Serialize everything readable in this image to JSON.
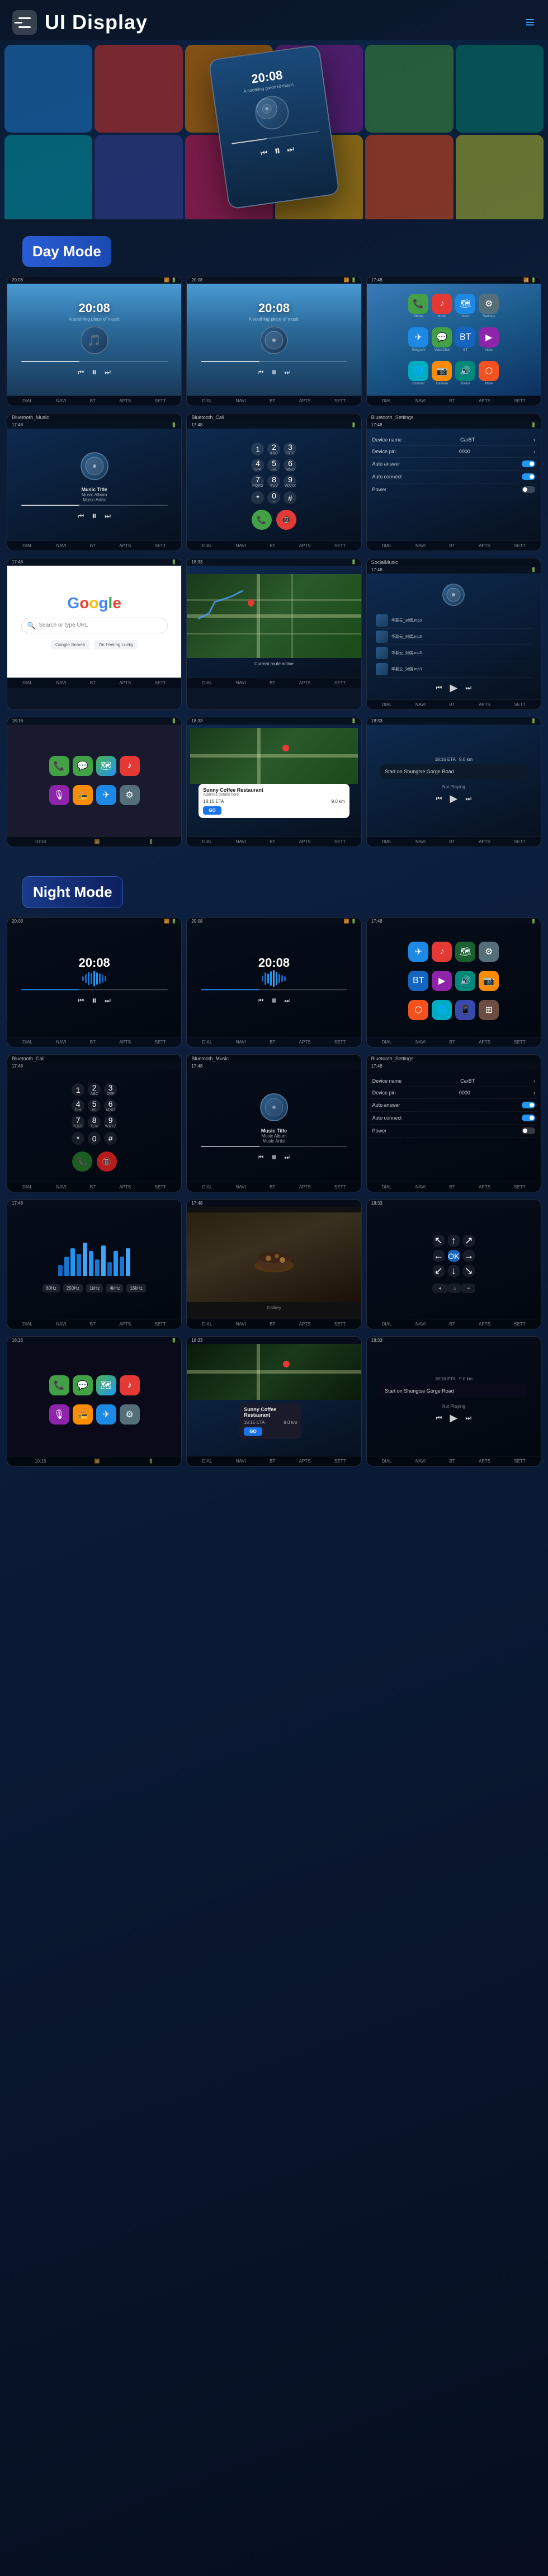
{
  "header": {
    "title": "UI Display",
    "menu_label": "menu",
    "nav_dots": "≡"
  },
  "sections": {
    "day_mode": "Day Mode",
    "night_mode": "Night Mode"
  },
  "hero": {
    "time": "20:08",
    "subtitle": "A soothing piece of music"
  },
  "day_screenshots": [
    {
      "id": "day-music-1",
      "time": "20:08",
      "subtitle": "A soothing piece of music",
      "type": "music_player",
      "header": "20:08"
    },
    {
      "id": "day-music-2",
      "time": "20:08",
      "subtitle": "A soothing piece of music",
      "type": "music_player"
    },
    {
      "id": "day-apps",
      "type": "app_grid"
    },
    {
      "id": "day-bt-music",
      "type": "bluetooth_music",
      "label": "Bluetooth_Music",
      "music_title": "Music Title",
      "music_album": "Music Album",
      "music_artist": "Music Artist"
    },
    {
      "id": "day-bt-call",
      "type": "bluetooth_call",
      "label": "Bluetooth_Call"
    },
    {
      "id": "day-bt-settings",
      "type": "bluetooth_settings",
      "label": "Bluetooth_Settings",
      "device_name": "CarBT",
      "device_pin": "0000"
    },
    {
      "id": "day-google",
      "type": "google"
    },
    {
      "id": "day-map",
      "type": "map"
    },
    {
      "id": "day-social",
      "type": "social_music",
      "label": "SocialMusic"
    }
  ],
  "day_row2": [
    {
      "id": "day-apple-carplay",
      "type": "apple_carplay"
    },
    {
      "id": "day-sunny-coffee",
      "type": "sunny_coffee",
      "restaurant": "Sunny Coffee Restaurant",
      "address": "Address details here",
      "eta": "18:16 ETA",
      "distance": "9.0 km",
      "go_label": "GO"
    },
    {
      "id": "day-navigation",
      "type": "navigation",
      "route": "Start on Shungtse Gorge Road",
      "not_playing": "Not Playing"
    }
  ],
  "night_screenshots_row1": [
    {
      "id": "night-music-1",
      "type": "night_music",
      "time": "20:08"
    },
    {
      "id": "night-music-2",
      "type": "night_music",
      "time": "20:08"
    },
    {
      "id": "night-apps",
      "type": "night_apps"
    }
  ],
  "night_screenshots_row2": [
    {
      "id": "night-bt-call",
      "type": "night_bt_call",
      "label": "Bluetooth_Call"
    },
    {
      "id": "night-bt-music",
      "type": "night_bt_music",
      "label": "Bluetooth_Music",
      "music_title": "Music Title",
      "music_album": "Music Album",
      "music_artist": "Music Artist"
    },
    {
      "id": "night-bt-settings",
      "type": "night_bt_settings",
      "label": "Bluetooth_Settings",
      "device_name": "CarBT",
      "device_pin": "0000"
    }
  ],
  "night_screenshots_row3": [
    {
      "id": "night-equalizer",
      "type": "night_equalizer"
    },
    {
      "id": "night-photo",
      "type": "night_photo"
    },
    {
      "id": "night-nav-arrows",
      "type": "night_nav_arrows"
    }
  ],
  "night_row2_bottom": [
    {
      "id": "night-apple-carplay",
      "type": "night_apple_carplay"
    },
    {
      "id": "night-sunny-coffee",
      "type": "night_sunny_coffee",
      "restaurant": "Sunny Coffee Restaurant",
      "eta": "18:16 ETA",
      "distance": "9.0 km",
      "go_label": "GO"
    },
    {
      "id": "night-navigation",
      "type": "night_navigation",
      "route": "Start on Shungtse Gorge Road",
      "not_playing": "Not Playing"
    }
  ],
  "footer_nav": {
    "items": [
      "DIAL",
      "NAVI",
      "BT",
      "APTS",
      "APTS",
      "SETT"
    ]
  },
  "bluetooth": {
    "device_name_label": "Device name",
    "device_pin_label": "Device pin",
    "auto_answer_label": "Auto answer",
    "auto_connect_label": "Auto connect",
    "power_label": "Power",
    "device_name_val": "CarBT",
    "device_pin_val": "0000"
  },
  "music": {
    "title": "Music Title",
    "album": "Music Album",
    "artist": "Music Artist"
  },
  "social_music": {
    "items": [
      "华慕云_对偶.mp3",
      "华慕云_对偶.mp3",
      "华慕云_对偶.mp3",
      "华慕云_对偶.mp3"
    ]
  },
  "navigation": {
    "eta_label": "18:16 ETA",
    "distance": "9.0 km",
    "route": "Start on Shungtse Gorge Road",
    "not_playing": "Not Playing"
  }
}
